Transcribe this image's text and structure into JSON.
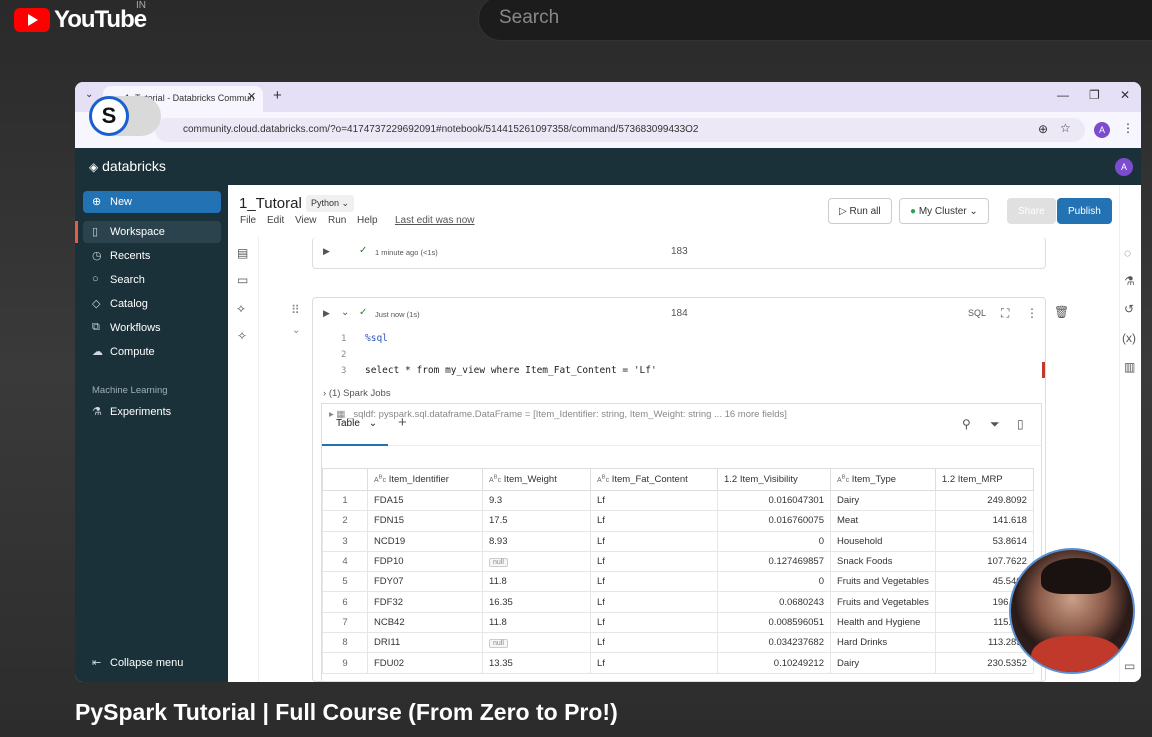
{
  "youtube": {
    "logo_text": "YouTube",
    "region": "IN",
    "search_placeholder": "Search",
    "video_title": "PySpark Tutorial | Full Course (From Zero to Pro!)"
  },
  "browser": {
    "tab_title": "1_Tutorial - Databricks Commun",
    "url": "community.cloud.databricks.com/?o=4174737229692091#notebook/514415261097358/command/573683099433O2",
    "profile_initial": "A",
    "extension_badge": "S"
  },
  "databricks": {
    "brand": "databricks",
    "user_initial": "A",
    "sidebar": {
      "new_label": "New",
      "items": [
        {
          "label": "Workspace",
          "icon": "folder-icon"
        },
        {
          "label": "Recents",
          "icon": "clock-icon"
        },
        {
          "label": "Search",
          "icon": "search-icon"
        },
        {
          "label": "Catalog",
          "icon": "catalog-icon"
        },
        {
          "label": "Workflows",
          "icon": "workflows-icon"
        },
        {
          "label": "Compute",
          "icon": "cloud-icon"
        }
      ],
      "section_ml": "Machine Learning",
      "experiments": "Experiments",
      "collapse": "Collapse menu"
    },
    "notebook": {
      "title": "1_Tutoral",
      "language": "Python",
      "menus": [
        "File",
        "Edit",
        "View",
        "Run",
        "Help"
      ],
      "last_edit": "Last edit was now",
      "run_all": "Run all",
      "cluster": "My Cluster",
      "share": "Share",
      "publish": "Publish"
    },
    "cell183": {
      "status": "1 minute ago (<1s)",
      "number": "183"
    },
    "cell184": {
      "status": "Just now (1s)",
      "number": "184",
      "lang_badge": "SQL",
      "code": [
        {
          "ln": "1",
          "text": "%sql"
        },
        {
          "ln": "2",
          "text": ""
        },
        {
          "ln": "3",
          "text": "select * from my_view where Item_Fat_Content = 'Lf'"
        }
      ],
      "spark_jobs": "(1) Spark Jobs",
      "df_info": "_sqldf:  pyspark.sql.dataframe.DataFrame = [Item_Identifier: string, Item_Weight: string ... 16 more fields]"
    },
    "results": {
      "tab_label": "Table",
      "columns": [
        "",
        "Item_Identifier",
        "Item_Weight",
        "Item_Fat_Content",
        "Item_Visibility",
        "Item_Type",
        "Item_MRP"
      ],
      "column_types": [
        "",
        "ABC",
        "ABC",
        "ABC",
        "1.2",
        "ABC",
        "1.2"
      ],
      "rows": [
        [
          "1",
          "FDA15",
          "9.3",
          "Lf",
          "0.016047301",
          "Dairy",
          "249.8092"
        ],
        [
          "2",
          "FDN15",
          "17.5",
          "Lf",
          "0.016760075",
          "Meat",
          "141.618"
        ],
        [
          "3",
          "NCD19",
          "8.93",
          "Lf",
          "0",
          "Household",
          "53.8614"
        ],
        [
          "4",
          "FDP10",
          "null",
          "Lf",
          "0.127469857",
          "Snack Foods",
          "107.7622"
        ],
        [
          "5",
          "FDY07",
          "11.8",
          "Lf",
          "0",
          "Fruits and Vegetables",
          "45.5402"
        ],
        [
          "6",
          "FDF32",
          "16.35",
          "Lf",
          "0.0680243",
          "Fruits and Vegetables",
          "196.442"
        ],
        [
          "7",
          "NCB42",
          "11.8",
          "Lf",
          "0.008596051",
          "Health and Hygiene",
          "115.349"
        ],
        [
          "8",
          "DRI11",
          "null",
          "Lf",
          "0.034237682",
          "Hard Drinks",
          "113.2834"
        ],
        [
          "9",
          "FDU02",
          "13.35",
          "Lf",
          "0.10249212",
          "Dairy",
          "230.5352"
        ]
      ]
    }
  },
  "colors": {
    "db_nav": "#1b3139",
    "accent_blue": "#2272b4",
    "youtube_red": "#ff0000"
  }
}
